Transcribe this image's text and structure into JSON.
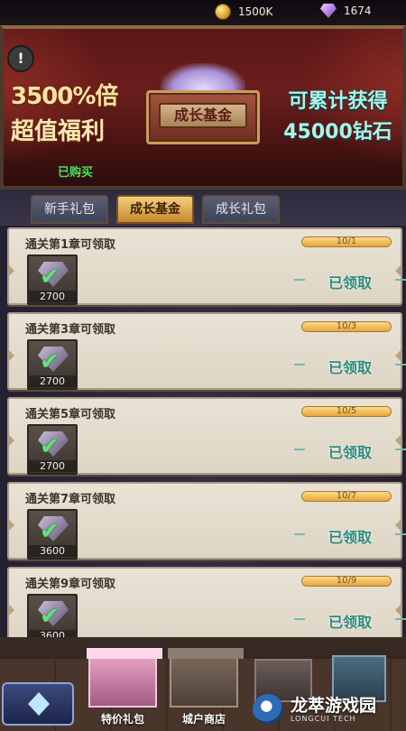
{
  "resources": {
    "gold": "1500K",
    "diamonds": "1674"
  },
  "banner": {
    "percent": "3500%倍",
    "value_text": "超值福利",
    "chest_label": "成长基金",
    "right_line1": "可累计获得",
    "right_line2": "45000钻石",
    "purchased": "已购买"
  },
  "tabs": [
    {
      "label": "新手礼包",
      "active": false
    },
    {
      "label": "成长基金",
      "active": true
    },
    {
      "label": "成长礼包",
      "active": false
    }
  ],
  "rewards": [
    {
      "title": "通关第1章可领取",
      "progress": "10/1",
      "amount": "2700",
      "status": "已领取"
    },
    {
      "title": "通关第3章可领取",
      "progress": "10/3",
      "amount": "2700",
      "status": "已领取"
    },
    {
      "title": "通关第5章可领取",
      "progress": "10/5",
      "amount": "2700",
      "status": "已领取"
    },
    {
      "title": "通关第7章可领取",
      "progress": "10/7",
      "amount": "3600",
      "status": "已领取"
    },
    {
      "title": "通关第9章可领取",
      "progress": "10/9",
      "amount": "3600",
      "status": "已领取"
    }
  ],
  "bottom": {
    "shop1": "特价礼包",
    "shop2": "城户商店"
  },
  "watermark": {
    "title": "龙萃游戏园",
    "subtitle": "LONGCUI TECH"
  },
  "colors": {
    "accent_gold": "#e6a63a",
    "claimed_teal": "#2c8a7c",
    "banner_red": "#6a1e1c"
  },
  "icons": [
    "coin-icon",
    "diamond-icon",
    "warning-icon",
    "gem-icon",
    "check-icon",
    "menu-icon"
  ]
}
